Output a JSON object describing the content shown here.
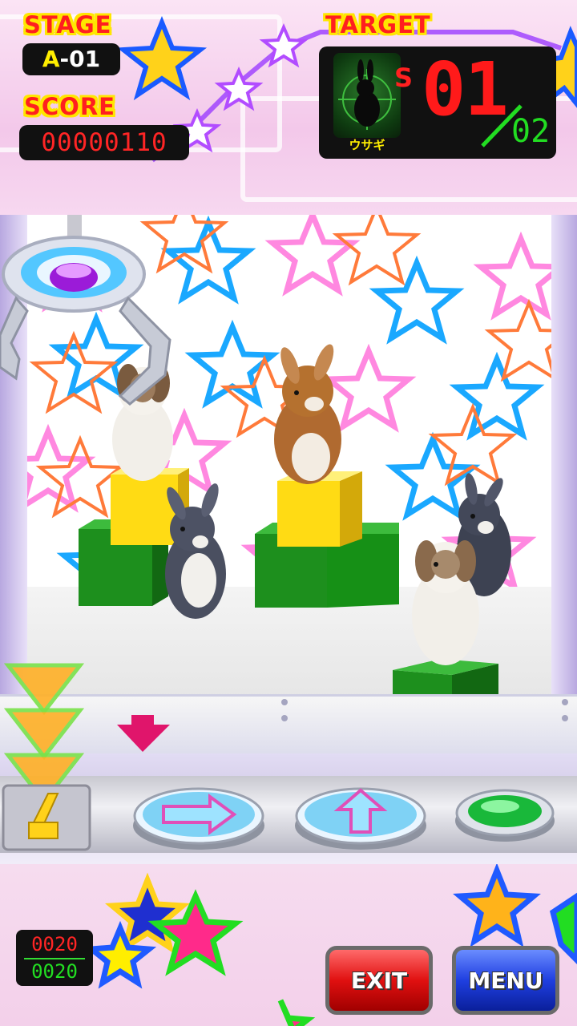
{
  "hud": {
    "stage_label": "STAGE",
    "stage_letter": "A",
    "stage_number": "-01",
    "score_label": "SCORE",
    "score_value": "00000110",
    "target_label": "TARGET",
    "target_rank": "S",
    "target_name": "ウサギ",
    "target_caught": "01",
    "target_total": "02"
  },
  "controls": {
    "move_right_icon": "arrow-right-icon",
    "move_up_icon": "arrow-up-icon",
    "action_icon": "green-button"
  },
  "credits": {
    "top": "0020",
    "bottom": "0020"
  },
  "buttons": {
    "exit_label": "EXIT",
    "menu_label": "MENU"
  },
  "colors": {
    "score_digits": "#ff2525",
    "total_digits": "#22dd22",
    "label_fill": "#ff1f1f",
    "label_outline": "#ffe600",
    "exit": "#e01010",
    "menu": "#1f3fe0"
  }
}
